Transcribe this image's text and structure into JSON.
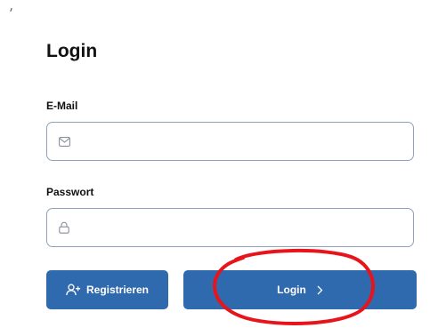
{
  "title": "Login",
  "email": {
    "label": "E-Mail",
    "value": "",
    "icon": "mail-icon"
  },
  "password": {
    "label": "Passwort",
    "value": "",
    "icon": "lock-icon"
  },
  "buttons": {
    "register_label": "Registrieren",
    "register_icon": "user-plus-icon",
    "login_label": "Login",
    "login_icon": "chevron-right-icon"
  },
  "colors": {
    "button_bg": "#2f69ae",
    "field_border": "#8fa2bd",
    "annotation": "#e8141c"
  }
}
